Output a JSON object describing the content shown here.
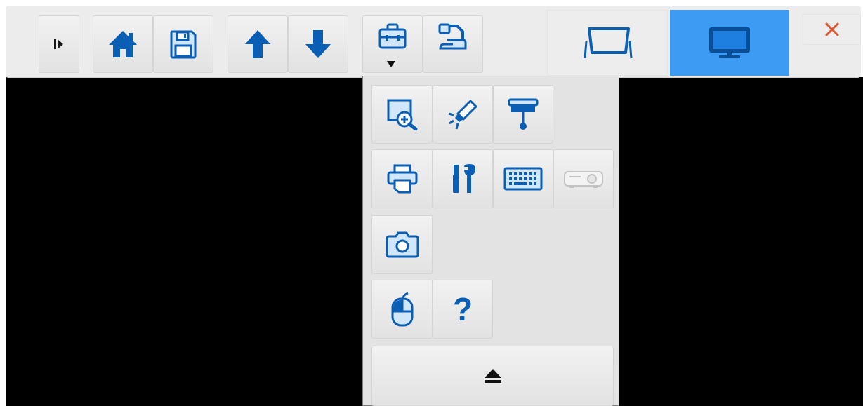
{
  "colors": {
    "icon_blue": "#0a5fb4",
    "icon_light_blue": "#cfe6fb",
    "active_bg": "#3d9bf3",
    "close_red": "#e0552f",
    "canvas_bg": "#000000",
    "toolbar_bg": "#ececec"
  },
  "toolbar": {
    "buttons": [
      {
        "name": "expand-toggle",
        "icon": "play-pause-icon"
      },
      {
        "name": "home",
        "icon": "home-icon"
      },
      {
        "name": "save",
        "icon": "floppy-disk-icon"
      },
      {
        "name": "move-up",
        "icon": "arrow-up-icon"
      },
      {
        "name": "move-down",
        "icon": "arrow-down-icon"
      },
      {
        "name": "tools",
        "icon": "toolbox-icon",
        "has_dropdown": true
      },
      {
        "name": "visualizer",
        "icon": "document-camera-icon"
      },
      {
        "name": "whiteboard-mode",
        "icon": "whiteboard-icon"
      },
      {
        "name": "desktop-mode",
        "icon": "monitor-icon",
        "active": true
      },
      {
        "name": "close",
        "icon": "close-icon"
      }
    ]
  },
  "tools_menu": {
    "rows": [
      [
        "magnifier-icon",
        "spotlight-icon",
        "screen-shade-icon"
      ],
      [
        "printer-icon",
        "settings-tools-icon",
        "keyboard-icon",
        "projector-icon"
      ],
      [
        "camera-icon"
      ],
      [
        "mouse-icon",
        "help-icon"
      ]
    ],
    "disabled": [
      "projector-icon"
    ],
    "help_label": "?",
    "collapse": "eject-icon"
  }
}
